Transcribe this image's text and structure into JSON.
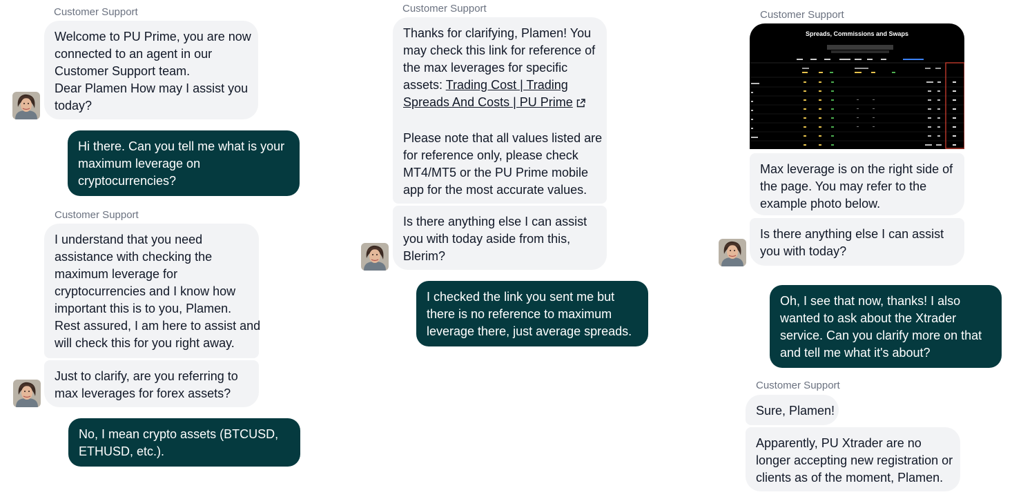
{
  "colors": {
    "agent_bubble": "#f2f3f5",
    "user_bubble": "#053a3f",
    "user_text": "#ffffff",
    "sender_label": "#6b7280",
    "example_photo_background": "#000000",
    "example_photo_highlight": "#c0392b"
  },
  "icons": {
    "avatar": "agent-avatar-icon",
    "external_link": "external-link-icon"
  },
  "column1": {
    "sender_1": "Customer Support",
    "msg_1": [
      "Welcome to PU Prime, you are now",
      "connected to an agent in our",
      "Customer Support team.",
      "Dear Plamen How may I assist you",
      "today?"
    ],
    "user_1": [
      "Hi there. Can you tell me what is your",
      "maximum leverage on",
      "cryptocurrencies?"
    ],
    "sender_2": "Customer Support",
    "msg_2": [
      "I understand that you need",
      "assistance with checking the",
      "maximum leverage for",
      "cryptocurrencies and I know how",
      "important this is to you, Plamen.",
      "Rest assured, I am here to assist and",
      "will check this for you right away."
    ],
    "msg_3": [
      "Just to clarify, are you referring to",
      "max leverages for forex assets?"
    ],
    "user_2": [
      "No, I mean crypto assets (BTCUSD,",
      "ETHUSD, etc.)."
    ]
  },
  "column2": {
    "sender_1": "Customer Support",
    "msg_1": {
      "line_1": "Thanks for clarifying, Plamen! You",
      "line_2": "may check this link for reference of",
      "line_3": "the max leverages for specific",
      "line_4_prefix": "assets: ",
      "link_line_1": "Trading Cost | Trading",
      "link_line_2": "Spreads And Costs | PU Prime",
      "note": [
        "Please note that all values listed are",
        "for reference only, please check",
        "MT4/MT5 or the PU Prime mobile",
        "app for the most accurate values."
      ]
    },
    "msg_2": [
      "Is there anything else I can assist",
      "you with today aside from this,",
      "Blerim?"
    ],
    "user_1": [
      "I checked the link you sent me but",
      "there is no reference to maximum",
      "leverage there, just average spreads."
    ]
  },
  "column3": {
    "sender_1": "Customer Support",
    "photo": {
      "title": "Spreads, Commissions and Swaps"
    },
    "msg_1": [
      "Max leverage is on the right side of",
      "the page. You may refer to the",
      "example photo below."
    ],
    "msg_2": [
      "Is there anything else I can assist",
      "you with today?"
    ],
    "user_1": [
      "Oh, I see that now, thanks! I also",
      "wanted to ask about the Xtrader",
      "service. Can you clarify more on that",
      "and tell me what it's about?"
    ],
    "sender_2": "Customer Support",
    "msg_3": [
      "Sure, Plamen!"
    ],
    "msg_4": [
      "Apparently, PU Xtrader are no",
      "longer accepting new registration or",
      "clients as of the moment, Plamen."
    ]
  }
}
